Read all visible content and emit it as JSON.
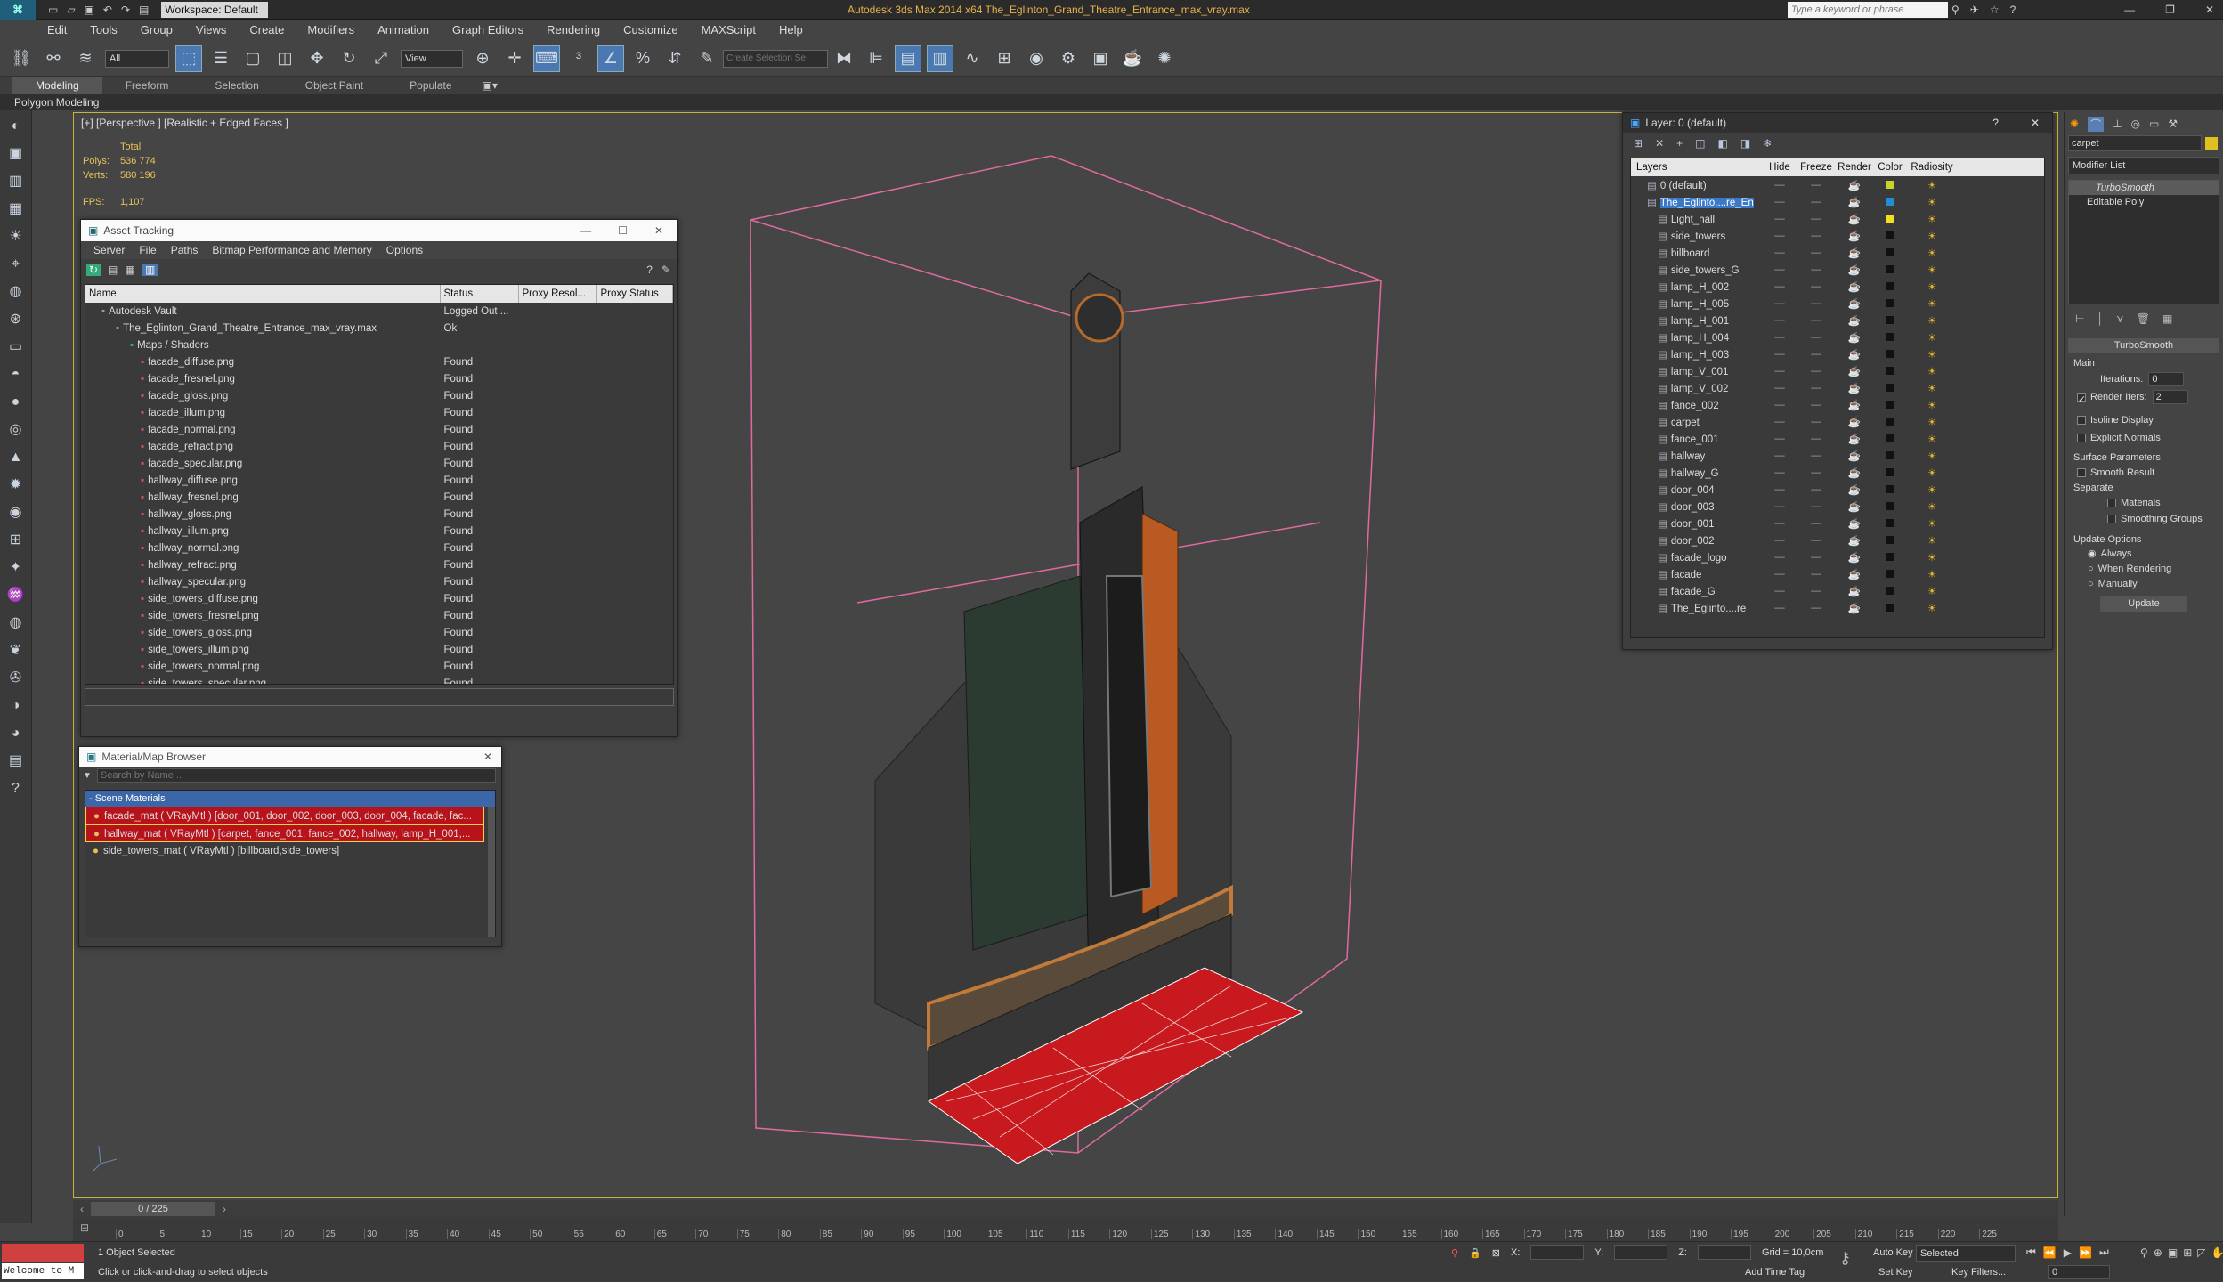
{
  "titlebar": {
    "workspace": "Workspace: Default",
    "title": "Autodesk 3ds Max  2014 x64     The_Eglinton_Grand_Theatre_Entrance_max_vray.max",
    "search_placeholder": "Type a keyword or phrase"
  },
  "menu": [
    "Edit",
    "Tools",
    "Group",
    "Views",
    "Create",
    "Modifiers",
    "Animation",
    "Graph Editors",
    "Rendering",
    "Customize",
    "MAXScript",
    "Help"
  ],
  "toolbar": {
    "filter_value": "All",
    "view_value": "View",
    "selection_set_placeholder": "Create Selection Se"
  },
  "ribbon": {
    "tabs": [
      "Modeling",
      "Freeform",
      "Selection",
      "Object Paint",
      "Populate"
    ],
    "sub": "Polygon Modeling"
  },
  "viewport": {
    "label": "[+] [Perspective ] [Realistic + Edged Faces ]",
    "stats_header": "Total",
    "polys_label": "Polys:",
    "polys_value": "536 774",
    "verts_label": "Verts:",
    "verts_value": "580 196",
    "fps_label": "FPS:",
    "fps_value": "1,107"
  },
  "asset_tracking": {
    "title": "Asset Tracking",
    "menu": [
      "Server",
      "File",
      "Paths",
      "Bitmap Performance and Memory",
      "Options"
    ],
    "columns": [
      "Name",
      "Status",
      "Proxy Resol...",
      "Proxy Status"
    ],
    "rows": [
      {
        "name": "Autodesk Vault",
        "status": "Logged Out ...",
        "indent": 1
      },
      {
        "name": "The_Eglinton_Grand_Theatre_Entrance_max_vray.max",
        "status": "Ok",
        "indent": 2
      },
      {
        "name": "Maps / Shaders",
        "status": "",
        "indent": 3
      },
      {
        "name": "facade_diffuse.png",
        "status": "Found",
        "indent": 4
      },
      {
        "name": "facade_fresnel.png",
        "status": "Found",
        "indent": 4
      },
      {
        "name": "facade_gloss.png",
        "status": "Found",
        "indent": 4
      },
      {
        "name": "facade_illum.png",
        "status": "Found",
        "indent": 4
      },
      {
        "name": "facade_normal.png",
        "status": "Found",
        "indent": 4
      },
      {
        "name": "facade_refract.png",
        "status": "Found",
        "indent": 4
      },
      {
        "name": "facade_specular.png",
        "status": "Found",
        "indent": 4
      },
      {
        "name": "hallway_diffuse.png",
        "status": "Found",
        "indent": 4
      },
      {
        "name": "hallway_fresnel.png",
        "status": "Found",
        "indent": 4
      },
      {
        "name": "hallway_gloss.png",
        "status": "Found",
        "indent": 4
      },
      {
        "name": "hallway_illum.png",
        "status": "Found",
        "indent": 4
      },
      {
        "name": "hallway_normal.png",
        "status": "Found",
        "indent": 4
      },
      {
        "name": "hallway_refract.png",
        "status": "Found",
        "indent": 4
      },
      {
        "name": "hallway_specular.png",
        "status": "Found",
        "indent": 4
      },
      {
        "name": "side_towers_diffuse.png",
        "status": "Found",
        "indent": 4
      },
      {
        "name": "side_towers_fresnel.png",
        "status": "Found",
        "indent": 4
      },
      {
        "name": "side_towers_gloss.png",
        "status": "Found",
        "indent": 4
      },
      {
        "name": "side_towers_illum.png",
        "status": "Found",
        "indent": 4
      },
      {
        "name": "side_towers_normal.png",
        "status": "Found",
        "indent": 4
      },
      {
        "name": "side_towers_specular.png",
        "status": "Found",
        "indent": 4
      }
    ]
  },
  "material_browser": {
    "title": "Material/Map Browser",
    "search_placeholder": "Search by Name ...",
    "group": "- Scene Materials",
    "items": [
      {
        "label": "facade_mat  ( VRayMtl ) [door_001, door_002, door_003, door_004, facade, fac...",
        "selected": true
      },
      {
        "label": "hallway_mat  ( VRayMtl )  [carpet, fance_001, fance_002, hallway, lamp_H_001,...",
        "selected": true
      },
      {
        "label": "side_towers_mat  ( VRayMtl ) [billboard,side_towers]",
        "selected": false
      }
    ]
  },
  "layer_explorer": {
    "title": "Layer: 0 (default)",
    "columns": [
      "Layers",
      "Hide",
      "Freeze",
      "Render",
      "Color",
      "Radiosity"
    ],
    "rows": [
      {
        "name": "0 (default)",
        "color": "#c8d42a",
        "level": 0
      },
      {
        "name": "The_Eglinto....re_En",
        "color": "#1e8fd6",
        "level": 0,
        "selected": true
      },
      {
        "name": "Light_hall",
        "color": "#f0e020",
        "level": 1
      },
      {
        "name": "side_towers",
        "color": "#111111",
        "level": 1
      },
      {
        "name": "billboard",
        "color": "#111111",
        "level": 1
      },
      {
        "name": "side_towers_G",
        "color": "#111111",
        "level": 1
      },
      {
        "name": "lamp_H_002",
        "color": "#111111",
        "level": 1
      },
      {
        "name": "lamp_H_005",
        "color": "#111111",
        "level": 1
      },
      {
        "name": "lamp_H_001",
        "color": "#111111",
        "level": 1
      },
      {
        "name": "lamp_H_004",
        "color": "#111111",
        "level": 1
      },
      {
        "name": "lamp_H_003",
        "color": "#111111",
        "level": 1
      },
      {
        "name": "lamp_V_001",
        "color": "#111111",
        "level": 1
      },
      {
        "name": "lamp_V_002",
        "color": "#111111",
        "level": 1
      },
      {
        "name": "fance_002",
        "color": "#111111",
        "level": 1
      },
      {
        "name": "carpet",
        "color": "#111111",
        "level": 1
      },
      {
        "name": "fance_001",
        "color": "#111111",
        "level": 1
      },
      {
        "name": "hallway",
        "color": "#111111",
        "level": 1
      },
      {
        "name": "hallway_G",
        "color": "#111111",
        "level": 1
      },
      {
        "name": "door_004",
        "color": "#111111",
        "level": 1
      },
      {
        "name": "door_003",
        "color": "#111111",
        "level": 1
      },
      {
        "name": "door_001",
        "color": "#111111",
        "level": 1
      },
      {
        "name": "door_002",
        "color": "#111111",
        "level": 1
      },
      {
        "name": "facade_logo",
        "color": "#111111",
        "level": 1
      },
      {
        "name": "facade",
        "color": "#111111",
        "level": 1
      },
      {
        "name": "facade_G",
        "color": "#111111",
        "level": 1
      },
      {
        "name": "The_Eglinto....re",
        "color": "#111111",
        "level": 1
      }
    ]
  },
  "command_panel": {
    "object_name": "carpet",
    "modifier_list": "Modifier List",
    "stack": [
      "TurboSmooth",
      "Editable Poly"
    ],
    "rollout": "TurboSmooth",
    "main_label": "Main",
    "iterations_label": "Iterations:",
    "iterations_value": "0",
    "render_iters_label": "Render Iters:",
    "render_iters_value": "2",
    "isoline": "Isoline Display",
    "explicit": "Explicit Normals",
    "surface_label": "Surface Parameters",
    "smooth_result": "Smooth Result",
    "separate_label": "Separate",
    "materials": "Materials",
    "smoothing_groups": "Smoothing Groups",
    "update_options": "Update Options",
    "always": "Always",
    "when_rendering": "When Rendering",
    "manually": "Manually",
    "update_button": "Update"
  },
  "timeline": {
    "frame": "0 / 225",
    "ticks": [
      "0",
      "5",
      "10",
      "15",
      "20",
      "25",
      "30",
      "35",
      "40",
      "45",
      "50",
      "55",
      "60",
      "65",
      "70",
      "75",
      "80",
      "85",
      "90",
      "95",
      "100",
      "105",
      "110",
      "115",
      "120",
      "125",
      "130",
      "135",
      "140",
      "145",
      "150",
      "155",
      "160",
      "165",
      "170",
      "175",
      "180",
      "185",
      "190",
      "195",
      "200",
      "205",
      "210",
      "215",
      "220",
      "225"
    ]
  },
  "status": {
    "maxscript": "Welcome to M",
    "selected": "1 Object Selected",
    "prompt": "Click or click-and-drag to select objects",
    "x_label": "X:",
    "y_label": "Y:",
    "z_label": "Z:",
    "grid": "Grid = 10,0cm",
    "autokey": "Auto Key",
    "selected_dropdown": "Selected",
    "setkey": "Set Key",
    "keyfilters": "Key Filters...",
    "addtimetag": "Add Time Tag",
    "frame_value": "0"
  }
}
